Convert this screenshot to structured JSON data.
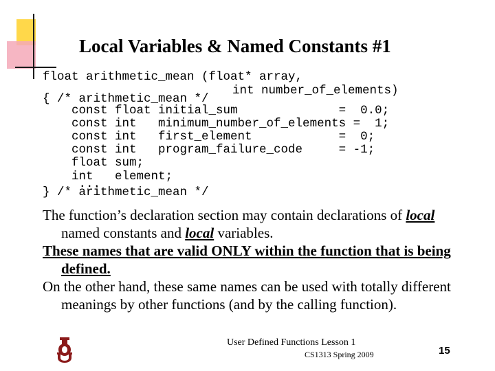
{
  "slide": {
    "title": "Local Variables & Named Constants #1",
    "code": {
      "line1": "float arithmetic_mean (float* array,",
      "line2": "int number_of_elements)",
      "line3": "{ /* arithmetic_mean */",
      "line4": "    const float initial_sum              =  0.0;",
      "line5": "    const int   minimum_number_of_elements =  1;",
      "line6": "    const int   first_element            =  0;",
      "line7": "    const int   program_failure_code     = -1;",
      "line8": "    float sum;",
      "line9": "    int   element;",
      "line10": "     ...",
      "line11": "} /* arithmetic_mean */"
    },
    "paragraph1": {
      "part1": "The function’s declaration section may contain declarations of ",
      "local1": "local",
      "part2": " named constants and ",
      "local2": "local",
      "part3": " variables."
    },
    "paragraph2": "These names that are valid ONLY within the function that is being defined.",
    "paragraph3": "On the other hand, these same names can be used with totally different meanings by other functions (and by the calling function).",
    "footer": {
      "lesson": "User Defined Functions Lesson 1",
      "course": "CS1313 Spring 2009",
      "page_number": "15"
    }
  }
}
